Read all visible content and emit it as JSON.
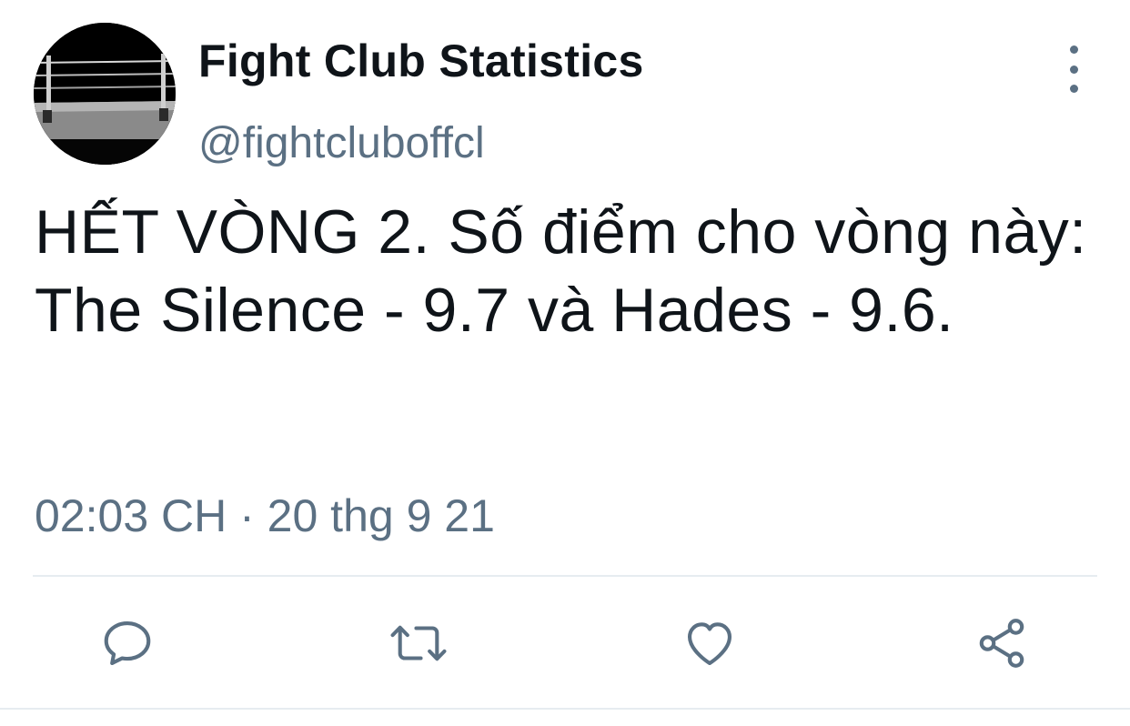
{
  "author": {
    "display_name": "Fight Club Statistics",
    "handle": "@fightcluboffcl",
    "avatar_icon": "boxing-ring-avatar"
  },
  "tweet": {
    "text": "HẾT VÒNG 2. Số điểm cho vòng này: The Silence - 9.7 và Hades - 9.6.",
    "timestamp": "02:03 CH · 20 thg 9 21"
  },
  "actions": {
    "reply_icon": "reply-icon",
    "retweet_icon": "retweet-icon",
    "like_icon": "heart-icon",
    "share_icon": "share-icon",
    "more_icon": "more-vertical-icon"
  },
  "colors": {
    "text_primary": "#0f1419",
    "text_secondary": "#5b7083",
    "divider": "#e6ecf0"
  }
}
